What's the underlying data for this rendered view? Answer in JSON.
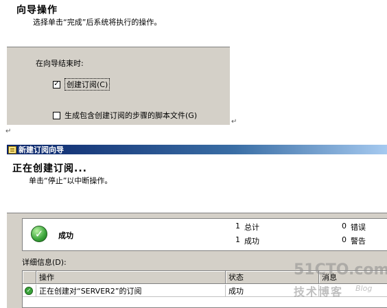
{
  "top": {
    "title": "向导操作",
    "subtitle": "选择单击“完成”后系统将执行的操作。",
    "panel_caption": "在向导结束时:",
    "option1_label": "创建订阅(C)",
    "option1_checked": true,
    "option2_label": "生成包含创建订阅的步骤的脚本文件(G)",
    "option2_checked": false,
    "para_mark": "↵"
  },
  "dialog": {
    "title": "新建订阅向导",
    "header_title": "正在创建订阅...",
    "header_subtitle": "单击“停止”以中断操作。",
    "status": {
      "label": "成功",
      "total_count": "1",
      "total_label": "总计",
      "success_count": "1",
      "success_label": "成功",
      "error_count": "0",
      "error_label": "错误",
      "warning_count": "0",
      "warning_label": "警告"
    },
    "details_label": "详细信息(D):",
    "columns": [
      "操作",
      "状态",
      "消息"
    ],
    "rows": [
      {
        "action": "正在创建对“SERVER2”的订阅",
        "status": "成功",
        "message": ""
      }
    ]
  },
  "watermark": {
    "logo": "51CTO.com",
    "sub": "技术博客",
    "blog": "Blog"
  }
}
